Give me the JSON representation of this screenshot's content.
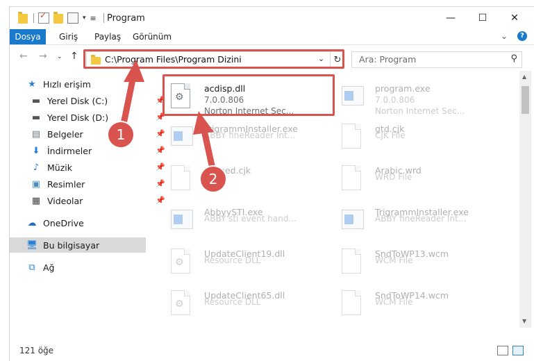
{
  "window": {
    "title": "Program",
    "controls": {
      "minimize": "—",
      "maximize": "☐",
      "close": "✕"
    }
  },
  "ribbon": {
    "tabs": [
      "Dosya",
      "Giriş",
      "Paylaş",
      "Görünüm"
    ]
  },
  "address": {
    "path": "C:\\Program Files\\Program Dizini"
  },
  "search": {
    "placeholder": "Ara: Program"
  },
  "sidebar": {
    "items": [
      {
        "label": "Hızlı erişim",
        "icon": "star-icon"
      },
      {
        "label": "Yerel Disk (C:)",
        "icon": "drive-icon"
      },
      {
        "label": "Yerel Disk (D:)",
        "icon": "drive-icon"
      },
      {
        "label": "Belgeler",
        "icon": "documents-icon"
      },
      {
        "label": "İndirmeler",
        "icon": "downloads-icon"
      },
      {
        "label": "Müzik",
        "icon": "music-icon"
      },
      {
        "label": "Resimler",
        "icon": "pictures-icon"
      },
      {
        "label": "Videolar",
        "icon": "videos-icon"
      },
      {
        "label": "OneDrive",
        "icon": "cloud-icon"
      },
      {
        "label": "Bu bilgisayar",
        "icon": "computer-icon"
      },
      {
        "label": "Ağ",
        "icon": "network-icon"
      }
    ]
  },
  "files": [
    {
      "name": "acdisp.dll",
      "meta1": "7.0.0.806",
      "meta2": "Norton Internet Sec...",
      "icon": "dll-icon",
      "highlighted": true
    },
    {
      "name": "program.exe",
      "meta1": "7.0.0.806",
      "meta2": "Norton Internet Sec...",
      "icon": "exe-icon"
    },
    {
      "name": "TrigrammInstaller.exe",
      "meta1": "ABBY fineReader Int...",
      "meta2": "",
      "icon": "exe-icon"
    },
    {
      "name": "gtd.cjk",
      "meta1": "CJK File",
      "meta2": "",
      "icon": "file-icon"
    },
    {
      "name": "Fefined.cjk",
      "meta1": "",
      "meta2": "",
      "icon": "file-icon"
    },
    {
      "name": "Arabic.wrd",
      "meta1": "WRD File",
      "meta2": "",
      "icon": "file-icon"
    },
    {
      "name": "AbbyySTI.exe",
      "meta1": "ABBY sti event hand...",
      "meta2": "",
      "icon": "exe-icon"
    },
    {
      "name": "TrigrammInstaller.exe",
      "meta1": "ABBY fineReader Int...",
      "meta2": "",
      "icon": "exe-icon"
    },
    {
      "name": "UpdateClient19.dll",
      "meta1": "Resource DLL",
      "meta2": "",
      "icon": "dll-icon"
    },
    {
      "name": "SndToWP13.wcm",
      "meta1": "WCM File",
      "meta2": "",
      "icon": "file-icon"
    },
    {
      "name": "UpdateClient65.dll",
      "meta1": "Resource DLL",
      "meta2": "",
      "icon": "dll-icon"
    },
    {
      "name": "SndToWP14.wcm",
      "meta1": "WCM File",
      "meta2": "",
      "icon": "file-icon"
    }
  ],
  "status": {
    "count": "121 öğe"
  },
  "annotations": {
    "badge1": "1",
    "badge2": "2",
    "color": "#d9534f"
  }
}
